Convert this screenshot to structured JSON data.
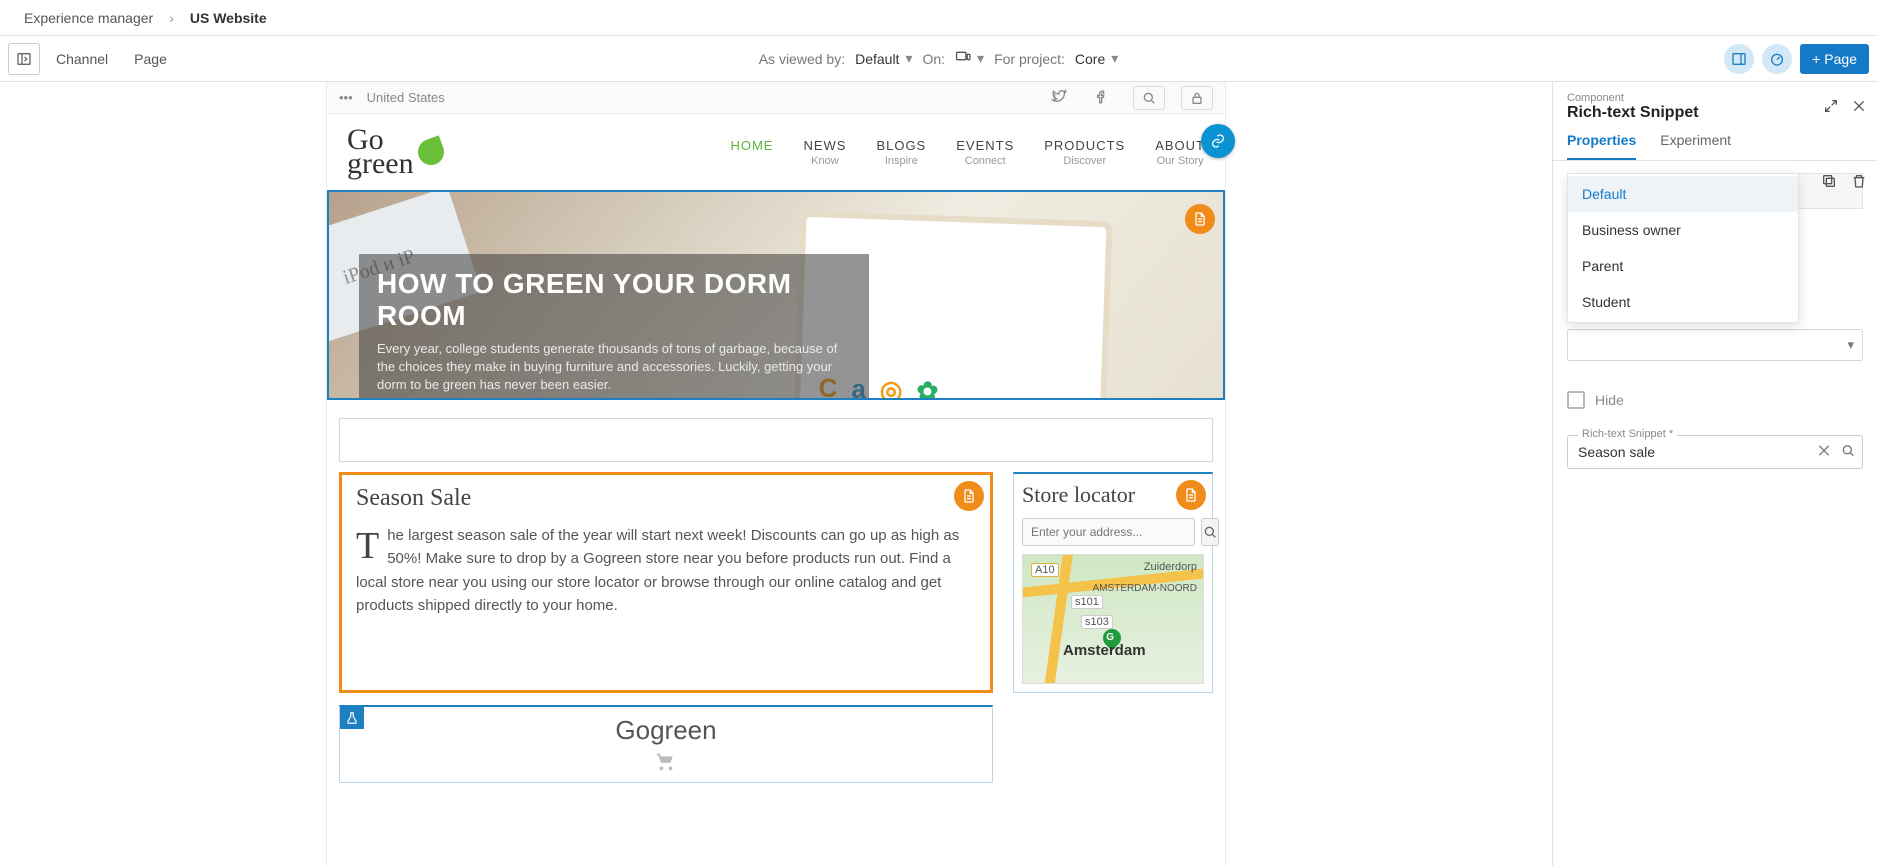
{
  "breadcrumb": {
    "root": "Experience manager",
    "current": "US Website"
  },
  "toolbar": {
    "channel": "Channel",
    "page": "Page",
    "viewed_lbl": "As viewed by:",
    "viewed_val": "Default",
    "on_lbl": "On:",
    "project_lbl": "For project:",
    "project_val": "Core",
    "add_page": "Page"
  },
  "site": {
    "topbar": {
      "country": "United States"
    },
    "logo": {
      "line1": "Go",
      "line2": "green"
    },
    "nav": [
      {
        "t": "HOME",
        "s": ""
      },
      {
        "t": "NEWS",
        "s": "Know"
      },
      {
        "t": "BLOGS",
        "s": "Inspire"
      },
      {
        "t": "EVENTS",
        "s": "Connect"
      },
      {
        "t": "PRODUCTS",
        "s": "Discover"
      },
      {
        "t": "ABOUT",
        "s": "Our Story"
      }
    ],
    "hero": {
      "title": "HOW TO GREEN YOUR DORM ROOM",
      "body": "Every year, college students generate thousands of tons of garbage, because of the choices they make in buying furniture and accessories. Luckily, getting your dorm to be green has never been easier."
    },
    "season": {
      "heading": "Season Sale",
      "dropcap": "T",
      "body": "he largest season sale of the year will start next week! Discounts can go up as high as 50%! Make sure to drop by a Gogreen store near you before products run out. Find a local store near you using our store locator or browse through our online catalog and get products shipped directly to your home."
    },
    "locator": {
      "heading": "Store locator",
      "placeholder": "Enter your address...",
      "city": "Amsterdam",
      "labels": {
        "a10": "A10",
        "noord": "AMSTERDAM-NOORD",
        "zuid": "Zuiderdorp",
        "s101": "s101",
        "s103": "s103"
      }
    },
    "gogreen_block": "Gogreen"
  },
  "panel": {
    "eyebrow": "Component",
    "title": "Rich-text Snippet",
    "tabs": {
      "properties": "Properties",
      "experiment": "Experiment"
    },
    "variants": [
      {
        "label": "Default",
        "selected": true
      },
      {
        "label": "Business owner",
        "selected": false
      },
      {
        "label": "Parent",
        "selected": false
      },
      {
        "label": "Student",
        "selected": false
      }
    ],
    "hide_label": "Hide",
    "field": {
      "label": "Rich-text Snippet *",
      "value": "Season sale"
    }
  }
}
